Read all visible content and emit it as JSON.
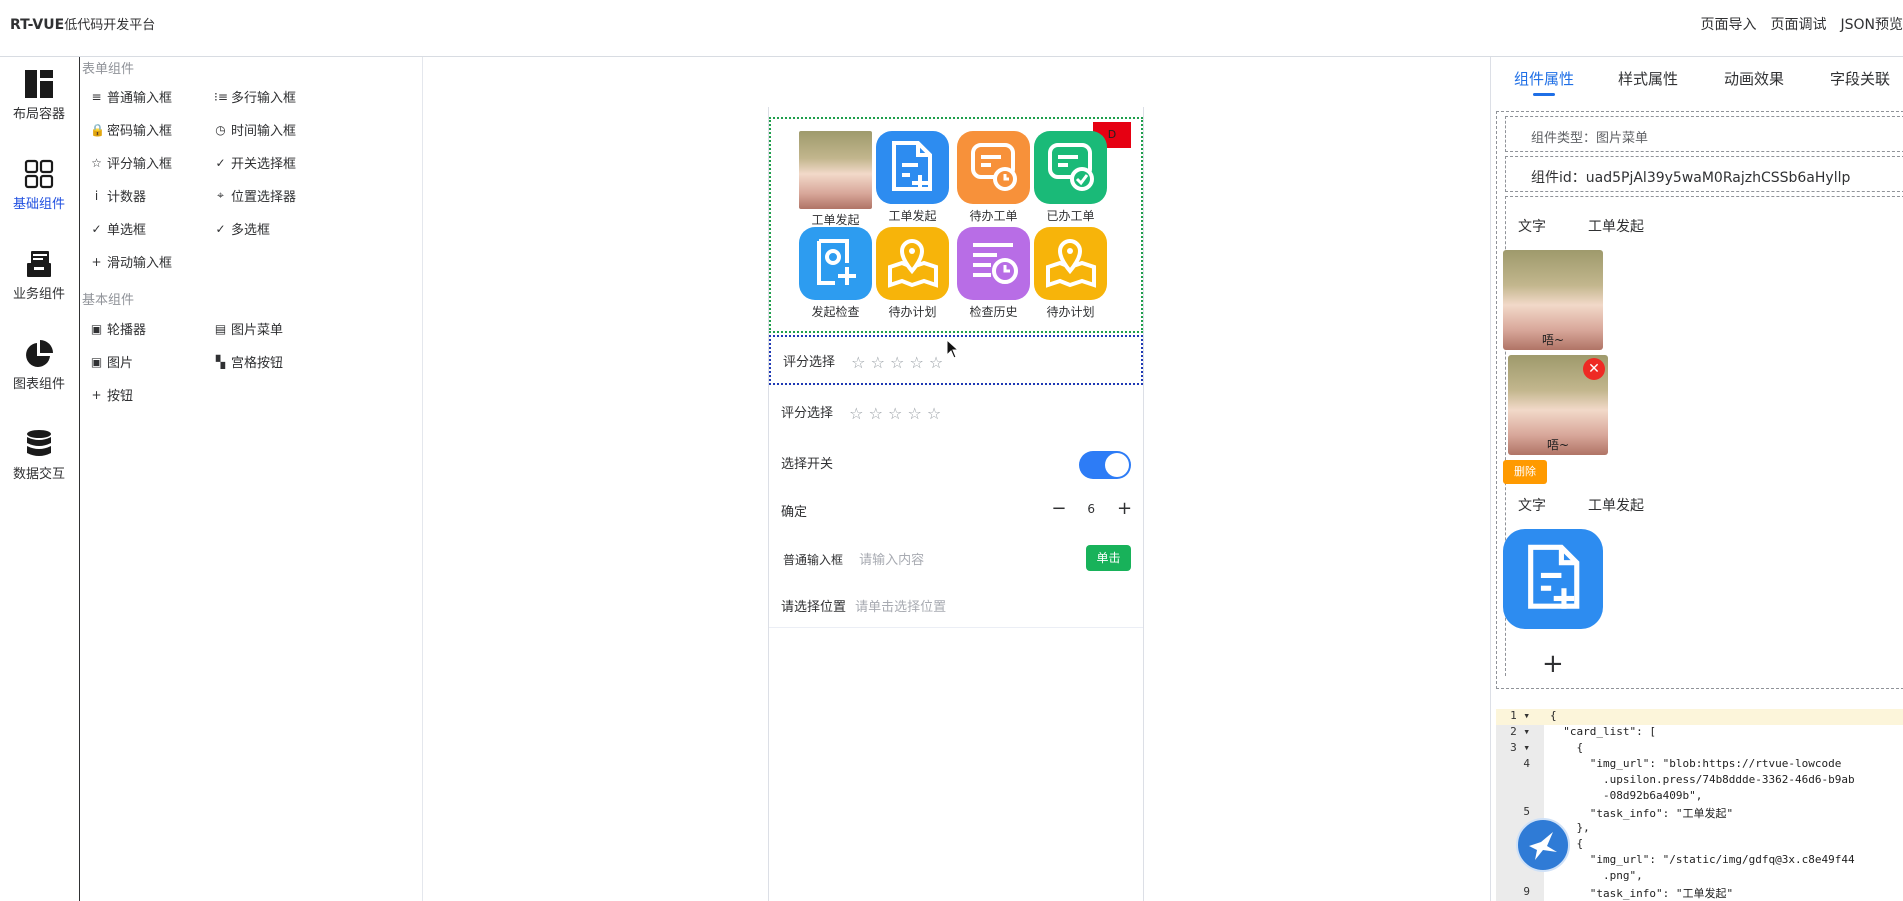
{
  "header": {
    "brand": "RT-VUE",
    "brand_sub": "低代码开发平台",
    "actions": [
      "页面导入",
      "页面调试",
      "JSON预览"
    ]
  },
  "nav": {
    "items": [
      {
        "label": "布局容器",
        "icon": "layout-icon"
      },
      {
        "label": "基础组件",
        "icon": "grid-icon"
      },
      {
        "label": "业务组件",
        "icon": "inbox-icon"
      },
      {
        "label": "图表组件",
        "icon": "pie-chart-icon"
      },
      {
        "label": "数据交互",
        "icon": "database-icon"
      }
    ],
    "active_index": 1
  },
  "palette": {
    "form_title": "表单组件",
    "form_items": [
      {
        "label": "普通输入框",
        "icon": "≡"
      },
      {
        "label": "多行输入框",
        "icon": "⁝≡"
      },
      {
        "label": "密码输入框",
        "icon": "🔒"
      },
      {
        "label": "时间输入框",
        "icon": "◷"
      },
      {
        "label": "评分输入框",
        "icon": "☆"
      },
      {
        "label": "开关选择框",
        "icon": "✓"
      },
      {
        "label": "计数器",
        "icon": "ⅰ"
      },
      {
        "label": "位置选择器",
        "icon": "⌖"
      },
      {
        "label": "单选框",
        "icon": "✓"
      },
      {
        "label": "多选框",
        "icon": "✓"
      },
      {
        "label": "滑动输入框",
        "icon": "+"
      }
    ],
    "basic_title": "基本组件",
    "basic_items": [
      {
        "label": "轮播器",
        "icon": "▣"
      },
      {
        "label": "图片菜单",
        "icon": "▤"
      },
      {
        "label": "图片",
        "icon": "▣"
      },
      {
        "label": "宫格按钮",
        "icon": "▚"
      },
      {
        "label": "按钮",
        "icon": "+"
      }
    ]
  },
  "canvas": {
    "delete_badge": "D",
    "menu": [
      {
        "label": "工单发起",
        "kind": "photo"
      },
      {
        "label": "工单发起",
        "color": "#2d8cf0",
        "icon": "document-plus-icon"
      },
      {
        "label": "待办工单",
        "color": "#f7913a",
        "icon": "form-clock-icon"
      },
      {
        "label": "已办工单",
        "color": "#1aba78",
        "icon": "form-check-icon"
      },
      {
        "label": "发起检查",
        "color": "#2d9cf0",
        "icon": "location-add-icon"
      },
      {
        "label": "待办计划",
        "color": "#f7b40a",
        "icon": "map-pin-icon"
      },
      {
        "label": "检查历史",
        "color": "#b86de6",
        "icon": "list-clock-icon"
      },
      {
        "label": "待办计划",
        "color": "#f7b40a",
        "icon": "map-pin-icon"
      }
    ],
    "rate1_label": "评分选择",
    "rate2_label": "评分选择",
    "stars": "☆ ☆ ☆ ☆ ☆",
    "switch_label": "选择开关",
    "stepper_label": "确定",
    "stepper_minus": "−",
    "stepper_value": "6",
    "stepper_plus": "+",
    "input_label": "普通输入框",
    "input_placeholder": "请输入内容",
    "input_button": "单击",
    "location_label": "请选择位置",
    "location_placeholder": "请单击选择位置"
  },
  "right": {
    "tabs": [
      "组件属性",
      "样式属性",
      "动画效果",
      "字段关联"
    ],
    "component_type": "组件类型：图片菜单",
    "component_id": "组件id：uad5PjAl39y5waM0RajzhCSSb6aHyllp",
    "text_label_1": "文字",
    "text_value_1": "工单发起",
    "photo_caption": "唔~",
    "photo_caption_2": "唔~",
    "close_glyph": "✕",
    "delete_button": "删除",
    "text_label_2": "文字",
    "text_value_2": "工单发起",
    "add_glyph": "+"
  },
  "code": [
    {
      "n": "1 ▾",
      "t": "{"
    },
    {
      "n": "2 ▾",
      "t": "  \"card_list\": ["
    },
    {
      "n": "3 ▾",
      "t": "    {"
    },
    {
      "n": "4",
      "t": "      \"img_url\": \"blob:https://rtvue-lowcode"
    },
    {
      "n": "",
      "t": "        .upsilon.press/74b8ddde-3362-46d6-b9ab"
    },
    {
      "n": "",
      "t": "        -08d92b6a409b\","
    },
    {
      "n": "5",
      "t": "      \"task_info\": \"工单发起\""
    },
    {
      "n": "",
      "t": "    },"
    },
    {
      "n": "",
      "t": "    {"
    },
    {
      "n": "",
      "t": "      \"img_url\": \"/static/img/gdfq@3x.c8e49f44"
    },
    {
      "n": "",
      "t": "        .png\","
    },
    {
      "n": "9",
      "t": "      \"task_info\": \"工单发起\""
    }
  ]
}
